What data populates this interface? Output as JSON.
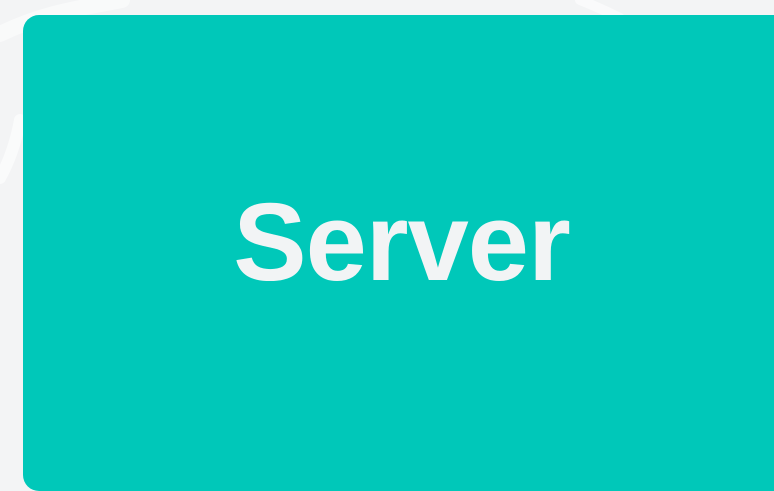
{
  "card": {
    "label": "Server",
    "background_color": "#00c8b9",
    "text_color": "#f2f4f5"
  },
  "page": {
    "background_color": "#f3f4f5"
  }
}
